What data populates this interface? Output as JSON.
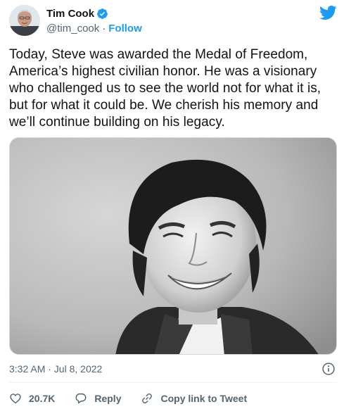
{
  "author": {
    "display_name": "Tim Cook",
    "handle": "@tim_cook",
    "separator": "·",
    "follow_label": "Follow",
    "verified_icon": "verified-badge-icon"
  },
  "tweet": {
    "text": "Today, Steve was awarded the Medal of Freedom, America’s highest civilian honor. He was a visionary who challenged us to see the world not for what it is, but for what it could be. We cherish his memory and we’ll continue building on his legacy.",
    "timestamp": "3:32 AM · Jul 8, 2022"
  },
  "actions": {
    "likes": "20.7K",
    "reply_label": "Reply",
    "copy_link_label": "Copy link to Tweet"
  },
  "icons": {
    "bird": "twitter-bird-icon",
    "info": "info-icon",
    "heart": "heart-icon",
    "reply": "reply-bubble-icon",
    "link": "link-icon"
  },
  "colors": {
    "accent": "#1d9bf0",
    "text": "#0f1419",
    "secondary": "#536471",
    "divider": "#eff3f4"
  }
}
